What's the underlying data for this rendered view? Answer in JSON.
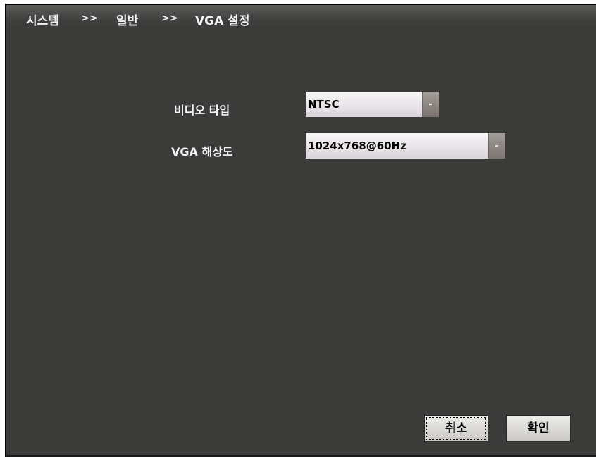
{
  "breadcrumb": {
    "system": "시스템",
    "sep1": ">>",
    "general": "일반",
    "sep2": ">>",
    "current": "VGA 설정"
  },
  "form": {
    "video_type": {
      "label": "비디오 타입",
      "value": "NTSC"
    },
    "vga_resolution": {
      "label": "VGA 해상도",
      "value": "1024x768@60Hz"
    }
  },
  "buttons": {
    "cancel": "취소",
    "confirm": "확인"
  },
  "icons": {
    "dropdown": "chevron-down-icon"
  },
  "colors": {
    "background": "#3b3c3a",
    "text": "#f5f5f5",
    "select_bg": "#e9e5e9",
    "button_bg": "#dcdbd8"
  }
}
